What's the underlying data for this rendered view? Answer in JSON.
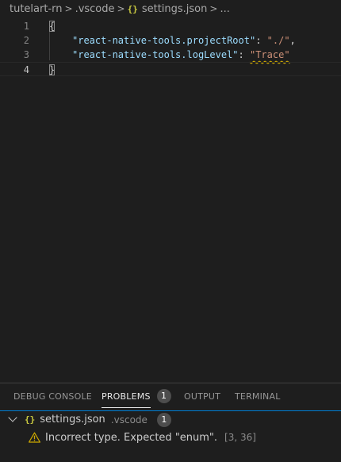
{
  "breadcrumb": {
    "items": [
      "tutelart-rn",
      ".vscode",
      "settings.json",
      "..."
    ],
    "json_icon": "{}",
    "separator": ">"
  },
  "editor": {
    "lines": [
      {
        "number": "1",
        "text": "{"
      },
      {
        "number": "2",
        "key": "\"react-native-tools.projectRoot\"",
        "colon": ": ",
        "value": "\"./\"",
        "comma": ","
      },
      {
        "number": "3",
        "key": "\"react-native-tools.logLevel\"",
        "colon": ": ",
        "value": "\"Trace\""
      },
      {
        "number": "4",
        "text": "}"
      }
    ]
  },
  "panel": {
    "tabs": [
      {
        "label": "DEBUG CONSOLE",
        "active": false
      },
      {
        "label": "PROBLEMS",
        "active": true,
        "badge": "1"
      },
      {
        "label": "OUTPUT",
        "active": false
      },
      {
        "label": "TERMINAL",
        "active": false
      }
    ],
    "problems": {
      "file": {
        "icon": "{}",
        "name": "settings.json",
        "dir": ".vscode",
        "count": "1"
      },
      "items": [
        {
          "severity_icon": "warning-icon",
          "message": "Incorrect type. Expected \"enum\".",
          "position": "[3, 36]"
        }
      ]
    }
  },
  "colors": {
    "background": "#1e1e1e",
    "string": "#ce9178",
    "key": "#9cdcfe",
    "warning": "#cca700",
    "json_icon": "#cbcb41",
    "focus_border": "#007fd4"
  }
}
